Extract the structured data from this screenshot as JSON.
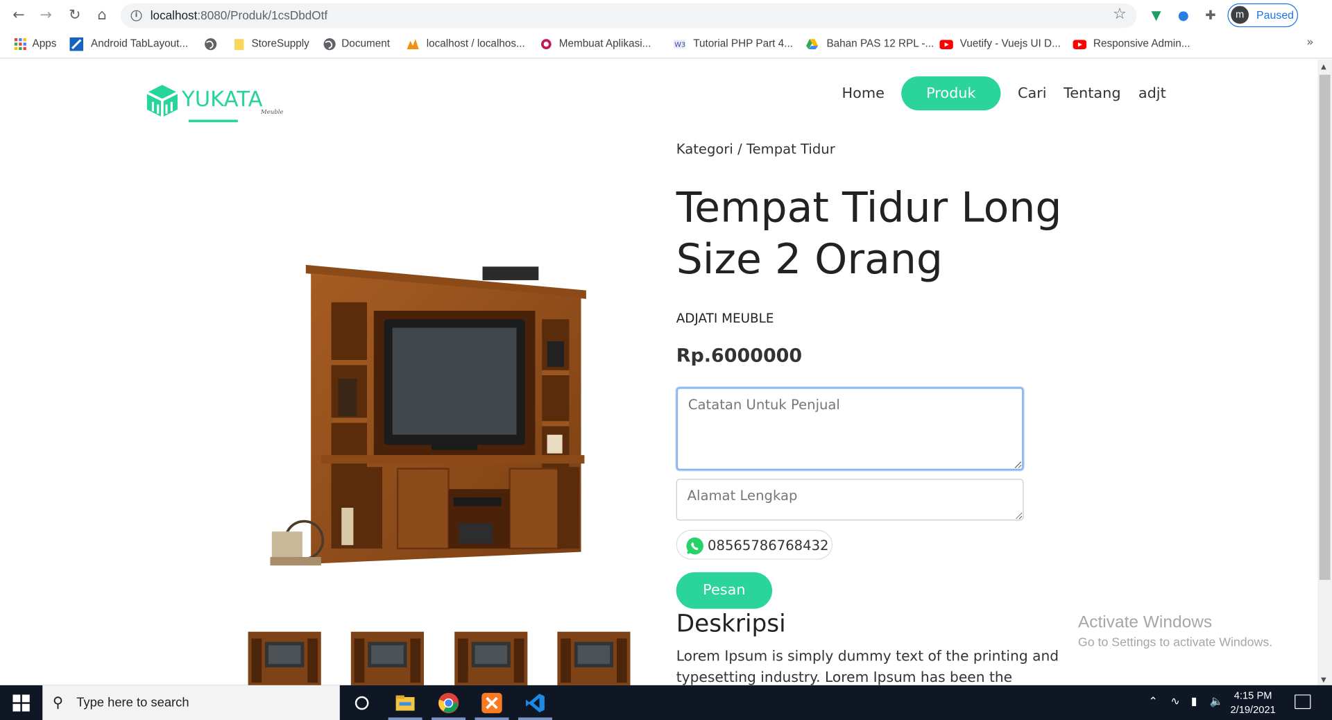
{
  "browser": {
    "url_host": "localhost",
    "url_path": ":8080/Produk/1csDbdOtf",
    "profile_initial": "m",
    "profile_status": "Paused",
    "bookmarks": [
      {
        "label": "Apps",
        "icon": "apps-grid-icon"
      },
      {
        "label": "Android TabLayout...",
        "icon": "android-tablayout-icon"
      },
      {
        "label": "",
        "icon": "globe-icon"
      },
      {
        "label": "StoreSupply",
        "icon": "folder-icon"
      },
      {
        "label": "Document",
        "icon": "globe-icon"
      },
      {
        "label": "localhost / localhos...",
        "icon": "phpmyadmin-icon"
      },
      {
        "label": "Membuat Aplikasi...",
        "icon": "site-icon"
      },
      {
        "label": "Tutorial PHP Part 4...",
        "icon": "site-icon"
      },
      {
        "label": "Bahan PAS 12 RPL -...",
        "icon": "google-drive-icon"
      },
      {
        "label": "Vuetify - Vuejs UI D...",
        "icon": "youtube-icon"
      },
      {
        "label": "Responsive Admin...",
        "icon": "youtube-icon"
      }
    ],
    "more_label": "»"
  },
  "site": {
    "logo_text": "YUKATA",
    "logo_sub": "Meuble",
    "brand_color": "#2ad49b",
    "menu": [
      {
        "label": "Home"
      },
      {
        "label": "Produk",
        "active": true
      },
      {
        "label": "Cari"
      },
      {
        "label": "Tentang"
      },
      {
        "label": "adjt"
      }
    ]
  },
  "product": {
    "breadcrumb": "Kategori / Tempat Tidur",
    "title": "Tempat Tidur Long Size 2 Orang",
    "seller": "ADJATI MEUBLE",
    "price": "Rp.6000000",
    "note_placeholder": "Catatan Untuk Penjual",
    "address_placeholder": "Alamat Lengkap",
    "whatsapp_number": "08565786768432",
    "order_button": "Pesan",
    "description_heading": "Deskripsi",
    "description_text": "Lorem Ipsum is simply dummy text of the printing and typesetting industry. Lorem Ipsum has been the industry's"
  },
  "watermark": {
    "title": "Activate Windows",
    "subtitle": "Go to Settings to activate Windows."
  },
  "taskbar": {
    "search_placeholder": "Type here to search",
    "time": "4:15 PM",
    "date": "2/19/2021"
  }
}
